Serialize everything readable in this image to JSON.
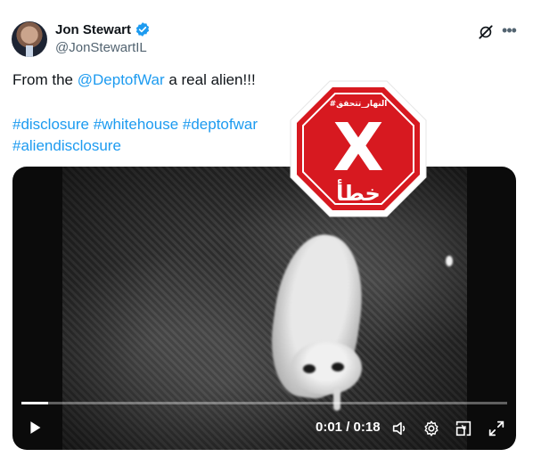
{
  "author": {
    "name": "Jon Stewart",
    "handle": "@JonStewartIL"
  },
  "tweet": {
    "text_before": "From the ",
    "mention": "@DeptofWar",
    "text_after": " a real alien!!!",
    "hashtags_line1": "#disclosure #whitehouse #deptofwar",
    "hashtags_line2": "#aliendisclosure"
  },
  "video": {
    "time_display": "0:01 / 0:18",
    "progress_fraction": 0.055
  },
  "stamp": {
    "top_text": "#النهار_تتحقق",
    "mark": "X",
    "verdict": "خطأ"
  },
  "colors": {
    "accent": "#1d9bf0",
    "stamp_red": "#d71920"
  },
  "icons": [
    "verified-badge-icon",
    "grok-icon",
    "more-icon",
    "play-icon",
    "volume-icon",
    "settings-icon",
    "pip-icon",
    "fullscreen-icon"
  ]
}
